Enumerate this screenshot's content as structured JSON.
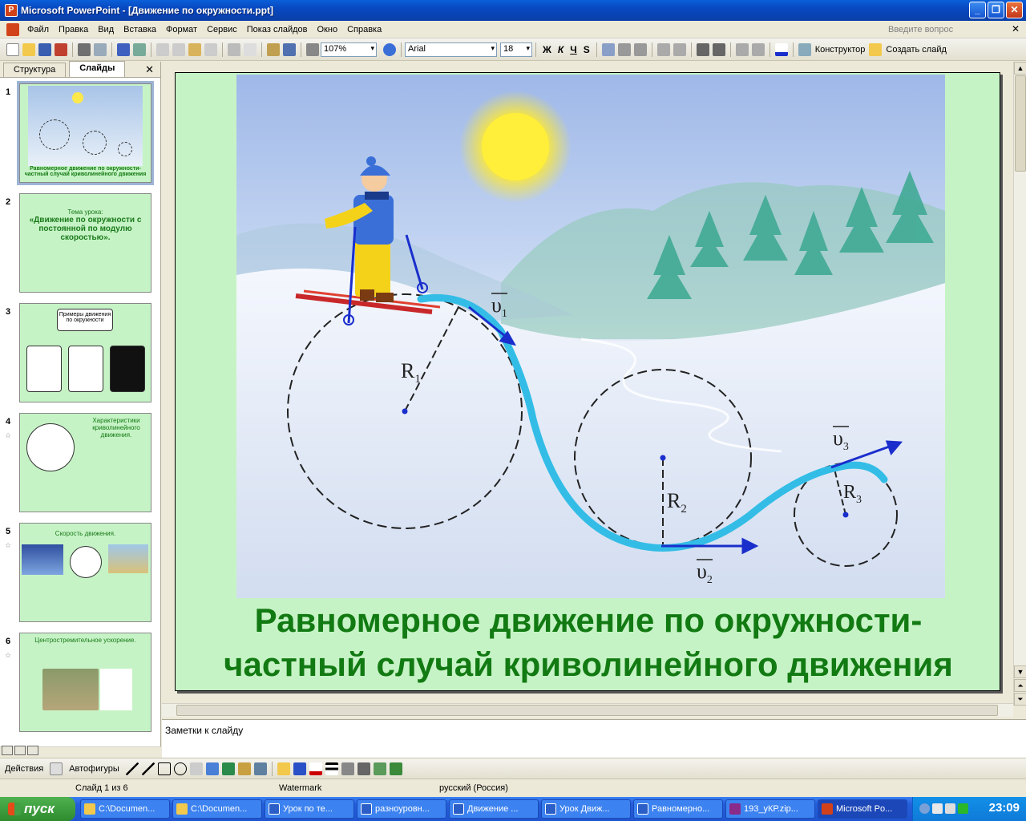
{
  "window": {
    "title": "Microsoft PowerPoint - [Движение по окружности.ppt]"
  },
  "menu": {
    "items": [
      "Файл",
      "Правка",
      "Вид",
      "Вставка",
      "Формат",
      "Сервис",
      "Показ слайдов",
      "Окно",
      "Справка"
    ],
    "help_placeholder": "Введите вопрос"
  },
  "toolbar": {
    "zoom": "107%",
    "font": "Arial",
    "font_size": "18",
    "bold": "Ж",
    "italic": "К",
    "underline": "Ч",
    "shadow": "S",
    "designer": "Конструктор",
    "new_slide": "Создать слайд"
  },
  "left_panel": {
    "tab_outline": "Структура",
    "tab_slides": "Слайды",
    "thumbnails": [
      {
        "num": "1",
        "text": "Равномерное движение по окружности- частный случай криволинейного движения"
      },
      {
        "num": "2",
        "text": "Тема урока:",
        "big": "«Движение по окружности с постоянной по модулю скоростью»."
      },
      {
        "num": "3",
        "text": "Примеры движения по окружности"
      },
      {
        "num": "4",
        "text": "Характеристики криволинейного движения."
      },
      {
        "num": "5",
        "text": "Скорость движения."
      },
      {
        "num": "6",
        "text": "Центростремительное ускорение."
      }
    ]
  },
  "slide": {
    "title_line1": "Равномерное движение по окружности-",
    "title_line2": "частный случай криволинейного  движения",
    "labels": {
      "r1": "R",
      "r1_sub": "1",
      "r2": "R",
      "r2_sub": "2",
      "r3": "R",
      "r3_sub": "3",
      "v1": "υ",
      "v1_sub": "1",
      "v2": "υ",
      "v2_sub": "2",
      "v3": "υ",
      "v3_sub": "3"
    }
  },
  "notes": {
    "placeholder": "Заметки к слайду"
  },
  "draw_toolbar": {
    "actions": "Действия",
    "autoshapes": "Автофигуры"
  },
  "status": {
    "slide": "Слайд 1 из 6",
    "design": "Watermark",
    "language": "русский (Россия)"
  },
  "taskbar": {
    "start": "пуск",
    "tasks": [
      "C:\\Documen...",
      "C:\\Documen...",
      "Урок по те...",
      "разноуровн...",
      "Движение ...",
      "Урок Движ...",
      "Равномерно...",
      "193_уКР.zip...",
      "Microsoft Po..."
    ],
    "clock": "23:09"
  },
  "colors": {
    "title_green": "#127a12",
    "slide_bg": "#c6f3c6",
    "track": "#33bde6",
    "vector": "#1a2ecc"
  }
}
